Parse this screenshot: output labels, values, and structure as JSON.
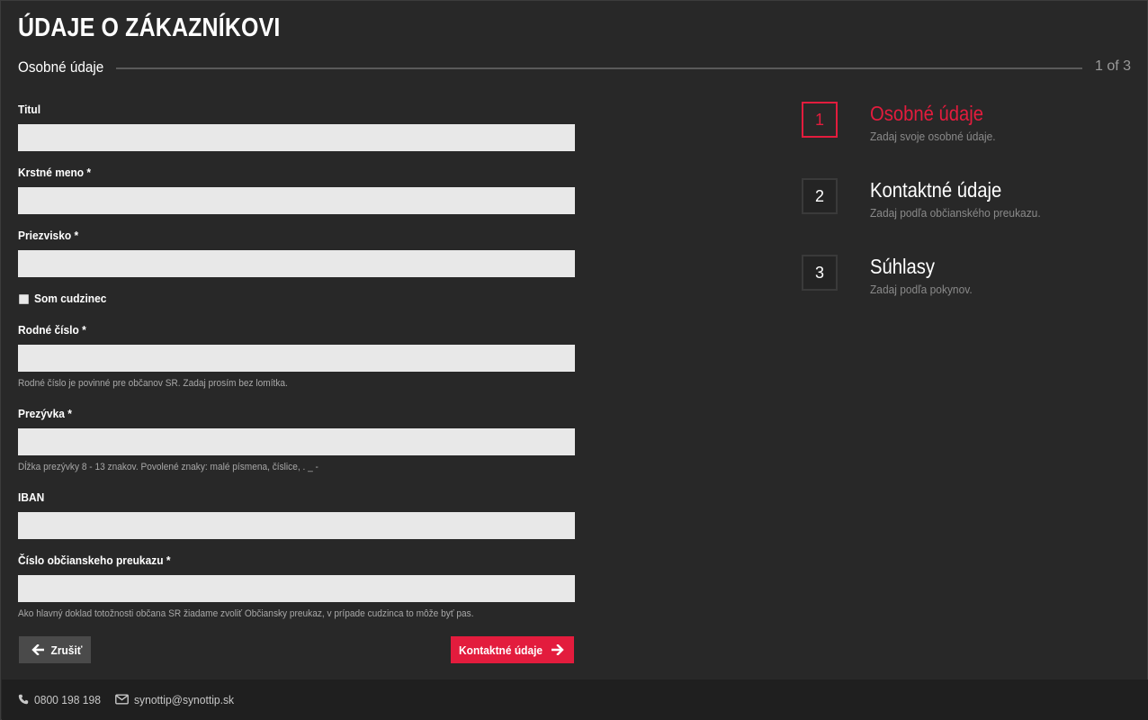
{
  "header": {
    "title": "ÚDAJE O ZÁKAZNÍKOVI",
    "section": "Osobné údaje",
    "step_counter": "1 of 3"
  },
  "form": {
    "title": {
      "label": "Titul",
      "value": ""
    },
    "first_name": {
      "label": "Krstné meno *",
      "value": ""
    },
    "last_name": {
      "label": "Priezvisko *",
      "value": ""
    },
    "foreigner": {
      "label": "Som cudzinec",
      "checked": false
    },
    "birth_number": {
      "label": "Rodné číslo *",
      "value": "",
      "hint": "Rodné číslo je povinné pre občanov SR. Zadaj prosím bez lomítka."
    },
    "nickname": {
      "label": "Prezývka *",
      "value": "",
      "hint": "Dĺžka prezývky 8 - 13 znakov. Povolené znaky: malé písmena, číslice, . _ -"
    },
    "iban": {
      "label": "IBAN",
      "value": ""
    },
    "id_card": {
      "label": "Číslo občianskeho preukazu *",
      "value": "",
      "hint": "Ako hlavný doklad totožnosti občana SR žiadame zvoliť Občiansky preukaz, v prípade cudzinca to môže byť pas."
    },
    "buttons": {
      "cancel": {
        "label": "Zrušiť",
        "icon": "arrow-left-icon"
      },
      "next": {
        "label": "Kontaktné údaje",
        "icon": "arrow-right-icon"
      }
    }
  },
  "steps": [
    {
      "number": "1",
      "title": "Osobné údaje",
      "description": "Zadaj svoje osobné údaje.",
      "active": true
    },
    {
      "number": "2",
      "title": "Kontaktné údaje",
      "description": "Zadaj podľa občianského preukazu.",
      "active": false
    },
    {
      "number": "3",
      "title": "Súhlasy",
      "description": "Zadaj podľa pokynov.",
      "active": false
    }
  ],
  "footer": {
    "phone": "0800 198 198",
    "email": "synottip@synottip.sk"
  },
  "colors": {
    "background": "#282828",
    "accent": "#e31c3d",
    "input_bg": "#e8e8e8",
    "footer_bg": "#1f1f1f"
  }
}
